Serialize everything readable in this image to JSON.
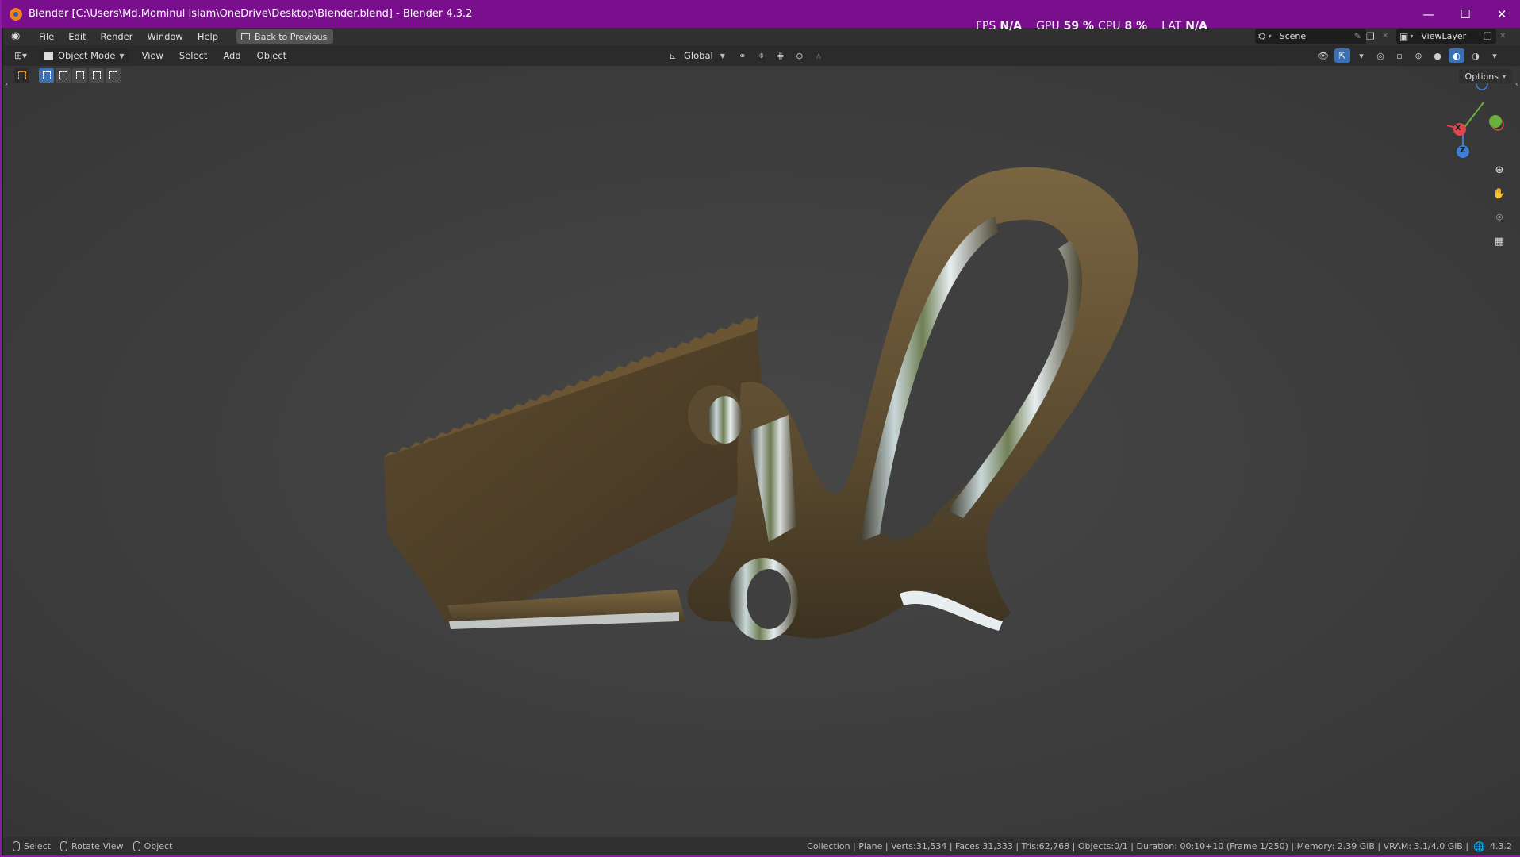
{
  "window": {
    "title": "Blender [C:\\Users\\Md.Mominul Islam\\OneDrive\\Desktop\\Blender.blend] - Blender 4.3.2",
    "minimize": "—",
    "maximize": "☐",
    "close": "✕"
  },
  "menu": {
    "file": "File",
    "edit": "Edit",
    "render": "Render",
    "window": "Window",
    "help": "Help",
    "back": "Back to Previous"
  },
  "stats": {
    "fps_label": "FPS",
    "fps_value": "N/A",
    "gpu_label": "GPU",
    "gpu_value": "59 %",
    "cpu_label": "CPU",
    "cpu_value": "8 %",
    "lat_label": "LAT",
    "lat_value": "N/A"
  },
  "scene": {
    "scene_name": "Scene",
    "view_layer": "ViewLayer"
  },
  "viewport_header": {
    "mode": "Object Mode",
    "view": "View",
    "select": "Select",
    "add": "Add",
    "object": "Object",
    "orientation": "Global",
    "options": "Options"
  },
  "gizmo": {
    "x": "X",
    "y": "Y",
    "z": "Z"
  },
  "statusbar": {
    "select": "Select",
    "rotate": "Rotate View",
    "object": "Object",
    "info": "Collection | Plane | Verts:31,534 | Faces:31,333 | Tris:62,768 | Objects:0/1 | Duration: 00:10+10 (Frame 1/250) | Memory: 2.39 GiB | VRAM: 3.1/4.0 GiB |",
    "version": "4.3.2"
  },
  "colors": {
    "titlebar": "#7a0f8e",
    "viewport_bg": "#3d3d3d",
    "accent_blue": "#3b6fb6",
    "axis_x": "#e0464e",
    "axis_y": "#6ab03f",
    "axis_z": "#3d7fd6"
  }
}
